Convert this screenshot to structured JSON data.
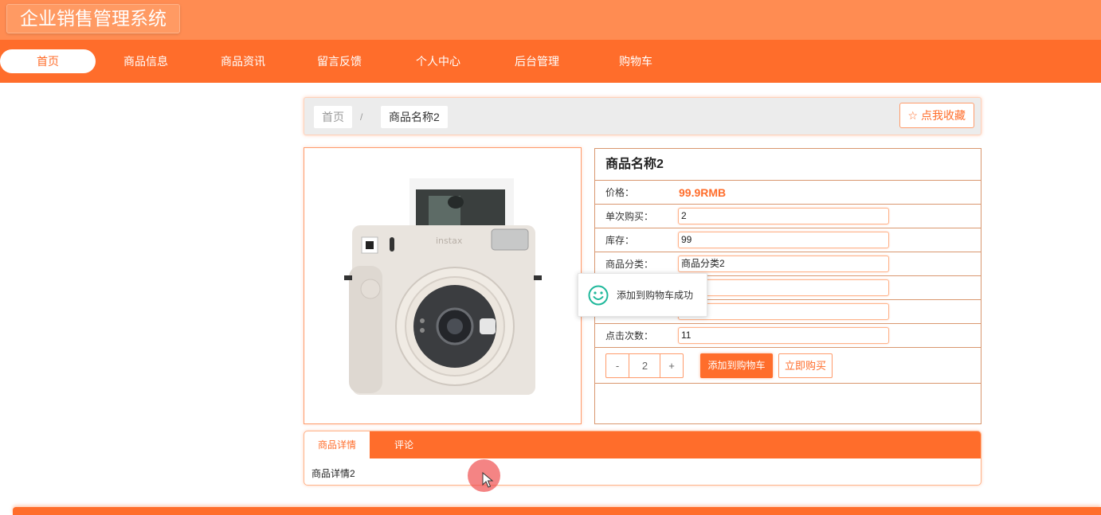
{
  "app": {
    "title": "企业销售管理系统"
  },
  "nav": {
    "items": [
      {
        "label": "首页",
        "active": true
      },
      {
        "label": "商品信息"
      },
      {
        "label": "商品资讯"
      },
      {
        "label": "留言反馈"
      },
      {
        "label": "个人中心"
      },
      {
        "label": "后台管理"
      },
      {
        "label": "购物车"
      }
    ]
  },
  "breadcrumb": {
    "home": "首页",
    "separator": "/",
    "current": "商品名称2"
  },
  "favorite": {
    "label": "☆ 点我收藏"
  },
  "product": {
    "name": "商品名称2",
    "price_label": "价格：",
    "price": "99.9RMB",
    "fields": [
      {
        "label": "单次购买：",
        "value": "2"
      },
      {
        "label": "库存：",
        "value": "99"
      },
      {
        "label": "商品分类：",
        "value": "商品分类2"
      },
      {
        "label": "",
        "value": ""
      },
      {
        "label": "",
        "value": ""
      },
      {
        "label": "点击次数：",
        "value": "11"
      }
    ]
  },
  "buy": {
    "minus": "-",
    "quantity": "2",
    "plus": "+",
    "add_to_cart": "添加到购物车",
    "buy_now": "立即购买"
  },
  "toast": {
    "message": "添加到购物车成功"
  },
  "tabs": {
    "items": [
      {
        "label": "商品详情",
        "active": true
      },
      {
        "label": "评论"
      }
    ],
    "content": "商品详情2"
  },
  "colors": {
    "accent": "#ff6d2b",
    "header": "#ff8c52",
    "toast_icon": "#1fb89b"
  }
}
